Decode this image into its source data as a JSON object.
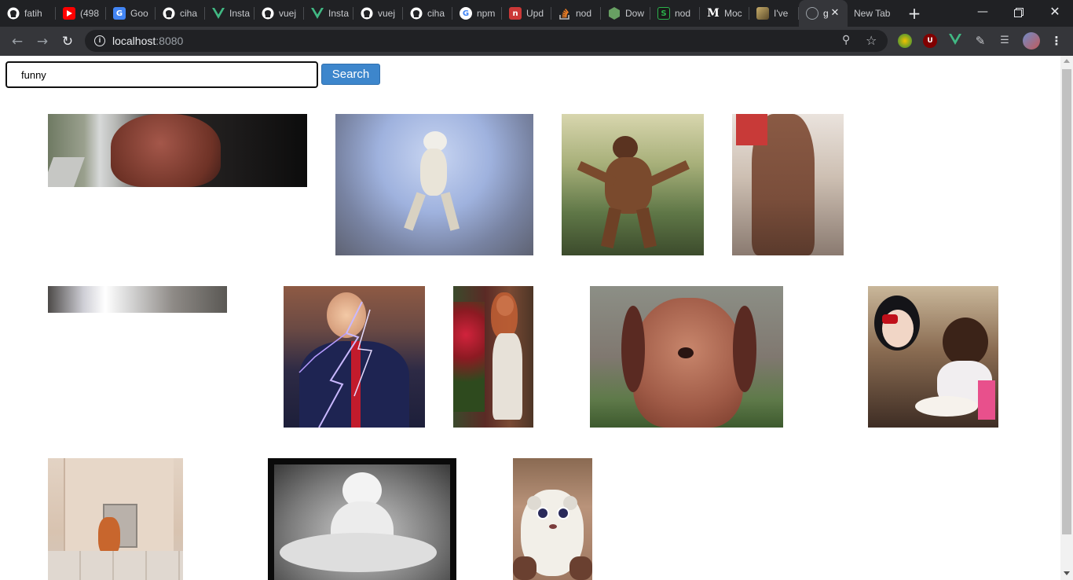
{
  "browser": {
    "tabs": [
      {
        "label": "fatih",
        "icon": "github-icon",
        "color": "#ffffff"
      },
      {
        "label": "(498",
        "icon": "youtube-icon",
        "color": "#ff0000"
      },
      {
        "label": "Goo",
        "icon": "google-translate-icon",
        "color": "#4285f4"
      },
      {
        "label": "ciha",
        "icon": "github-icon",
        "color": "#ffffff"
      },
      {
        "label": "Insta",
        "icon": "vue-icon",
        "color": "#41b883"
      },
      {
        "label": "vuej",
        "icon": "github-icon",
        "color": "#ffffff"
      },
      {
        "label": "Insta",
        "icon": "vue-icon",
        "color": "#41b883"
      },
      {
        "label": "vuej",
        "icon": "github-icon",
        "color": "#ffffff"
      },
      {
        "label": "ciha",
        "icon": "github-icon",
        "color": "#ffffff"
      },
      {
        "label": "npm",
        "icon": "google-icon",
        "color": "#ffffff"
      },
      {
        "label": "Upd",
        "icon": "npm-icon",
        "color": "#cb3837"
      },
      {
        "label": "nod",
        "icon": "stackoverflow-icon",
        "color": "#f48024"
      },
      {
        "label": "Dow",
        "icon": "nodejs-icon",
        "color": "#68a063"
      },
      {
        "label": "nod",
        "icon": "js-icon",
        "color": "#2bb24c"
      },
      {
        "label": "Moc",
        "icon": "medium-icon",
        "color": "#ffffff"
      },
      {
        "label": "I've",
        "icon": "image-icon",
        "color": "#a88a4a"
      },
      {
        "label": "g",
        "icon": "globe-icon",
        "color": "#9aa0a6",
        "active": true
      },
      {
        "label": "New Tab",
        "icon": "",
        "color": ""
      }
    ],
    "address": {
      "host": "localhost",
      "port": ":8080"
    }
  },
  "search": {
    "value": "funny",
    "button_label": "Search"
  },
  "gifs": [
    {
      "subject": "dog in car"
    },
    {
      "subject": "dancing chihuahua"
    },
    {
      "subject": "dancing orangutan"
    },
    {
      "subject": "dancing person"
    },
    {
      "subject": "bright room"
    },
    {
      "subject": "lightning man"
    },
    {
      "subject": "woman with roses"
    },
    {
      "subject": "smiling dog"
    },
    {
      "subject": "princess and child"
    },
    {
      "subject": "cat in cat door"
    },
    {
      "subject": "two cats"
    },
    {
      "subject": "plush toy"
    }
  ]
}
